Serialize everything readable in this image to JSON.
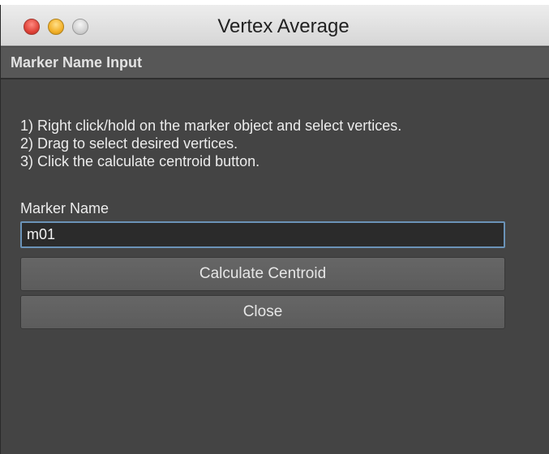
{
  "window": {
    "title": "Vertex Average"
  },
  "section": {
    "header": "Marker Name Input"
  },
  "instructions": [
    "1) Right click/hold on the marker object and select vertices.",
    "2) Drag to select desired vertices.",
    "3) Click the calculate centroid button."
  ],
  "marker_field": {
    "label": "Marker Name",
    "value": "m01"
  },
  "buttons": {
    "calculate": "Calculate Centroid",
    "close": "Close"
  },
  "colors": {
    "window_bg": "#444444",
    "section_header_bg": "#575757",
    "button_bg": "#5f5f5f",
    "input_focus_border": "#6b93b8",
    "traffic_close": "#e0443a",
    "traffic_minimize": "#f3b12a",
    "traffic_zoom": "#d2d2d2"
  },
  "icons": {
    "close": "close-traffic-light-icon",
    "minimize": "minimize-traffic-light-icon",
    "zoom": "zoom-traffic-light-icon"
  }
}
